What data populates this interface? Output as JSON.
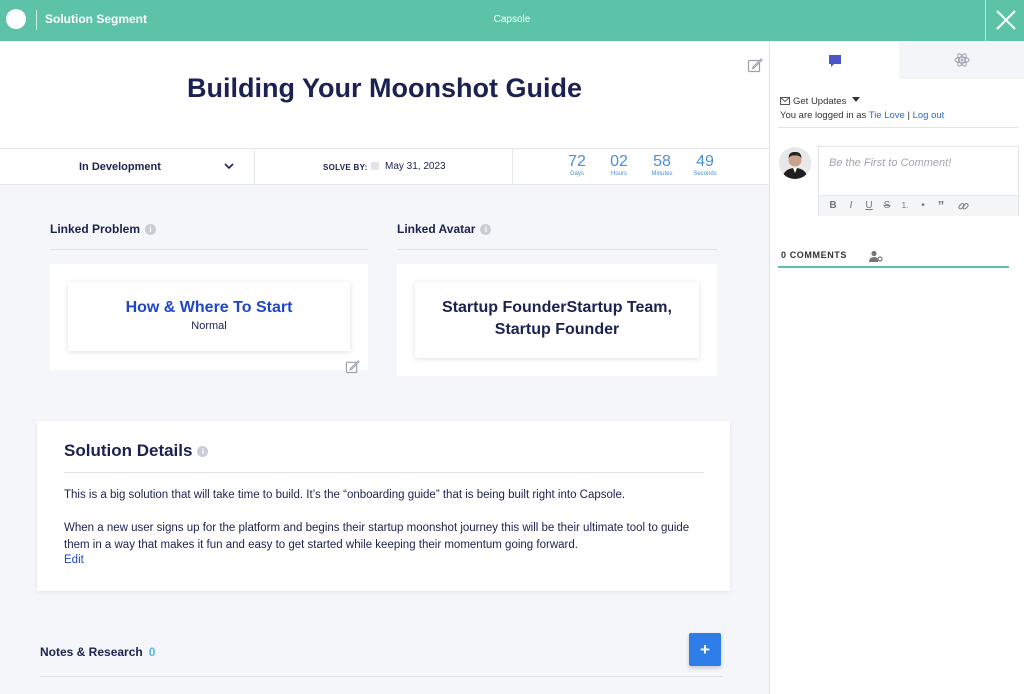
{
  "topbar": {
    "title": "Solution Segment",
    "app_name": "Capsole",
    "accent_color": "#5cc2a8",
    "close_icon": "close-icon"
  },
  "main": {
    "page_title": "Building Your Moonshot Guide",
    "status": {
      "value": "In Development",
      "icon": "chevron-down-icon"
    },
    "solve_by": {
      "label": "SOLVE BY:",
      "date": "May 31, 2023"
    },
    "countdown": [
      {
        "value": "72",
        "label": "Days"
      },
      {
        "value": "02",
        "label": "Hours"
      },
      {
        "value": "58",
        "label": "Minutes"
      },
      {
        "value": "49",
        "label": "Seconds"
      }
    ],
    "linked_problem": {
      "label": "Linked Problem",
      "title": "How & Where To Start",
      "level": "Normal"
    },
    "linked_avatar": {
      "label": "Linked Avatar",
      "text": "Startup FounderStartup Team, Startup Founder"
    },
    "solution_details": {
      "title": "Solution Details",
      "paragraph1": "This is a big solution that will take time to build. It’s the “onboarding guide” that is being built right into Capsole.",
      "paragraph2": "When a new user signs up for the platform and begins their startup moonshot journey this will be their ultimate tool to guide them in a way that makes it fun and easy to get started while keeping their momentum going forward.",
      "edit_label": "Edit"
    },
    "notes": {
      "label": "Notes & Research",
      "count": "0",
      "add_label": "+"
    },
    "link_color": "#1f45c9",
    "countdown_color": "#4a8fd8"
  },
  "sidebar": {
    "tabs": [
      {
        "icon": "comment-icon",
        "active": true
      },
      {
        "icon": "atom-icon",
        "active": false
      }
    ],
    "get_updates": "Get Updates",
    "logged_in_prefix": "You are logged in as",
    "user_name": "Tie Love",
    "separator": "|",
    "logout_label": "Log out",
    "comment_placeholder": "Be the First to Comment!",
    "toolbar": [
      "B",
      "I",
      "U",
      "S",
      "1.",
      "•",
      "”",
      "link"
    ],
    "comments_count": "0 COMMENTS"
  }
}
